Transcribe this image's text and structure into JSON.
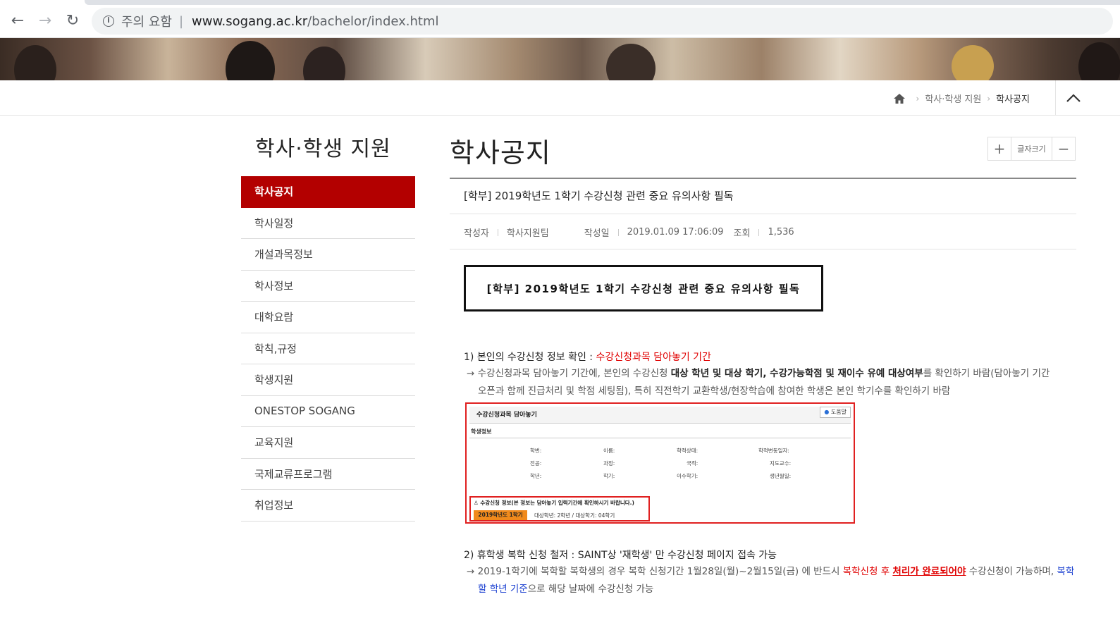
{
  "browser": {
    "security_warning": "주의 요함",
    "separator": "|",
    "url_host": "www.sogang.ac.kr",
    "url_path": "/bachelor/index.html",
    "back": "←",
    "forward": "→",
    "reload": "↻"
  },
  "breadcrumb": {
    "items": [
      "학사·학생 지원",
      "학사공지"
    ]
  },
  "lnb": {
    "title": "학사·학생 지원",
    "items": [
      {
        "label": "학사공지",
        "active": true
      },
      {
        "label": "학사일정"
      },
      {
        "label": "개설과목정보"
      },
      {
        "label": "학사정보"
      },
      {
        "label": "대학요람"
      },
      {
        "label": "학칙,규정"
      },
      {
        "label": "학생지원"
      },
      {
        "label": "ONESTOP SOGANG"
      },
      {
        "label": "교육지원"
      },
      {
        "label": "국제교류프로그램"
      },
      {
        "label": "취업정보"
      }
    ]
  },
  "content": {
    "page_title": "학사공지",
    "fontsize_label": "글자크기",
    "fontsize_plus": "+",
    "fontsize_minus": "−",
    "subject": "[학부] 2019학년도 1학기 수강신청 관련 중요 유의사항 필독",
    "meta": {
      "author_label": "작성자",
      "author": "학사지원팀",
      "date_label": "작성일",
      "date": "2019.01.09 17:06:09",
      "views_label": "조회",
      "views": "1,536"
    },
    "boxed_title": "[학부] 2019학년도 1학기 수강신청 관련 중요 유의사항 필독",
    "section1": {
      "head": "1) 본인의 수강신청 정보 확인 : ",
      "head_red": "수강신청과목 담아놓기 기간",
      "desc_a": "→ 수강신청과목 담아놓기 기간에, 본인의 수강신청 ",
      "desc_b": "대상 학년 및 대상 학기, 수강가능학점 및 재이수 유예 대상여부",
      "desc_c": "를 확인하기 바람(담아놓기 기간",
      "desc_line2": "오픈과 함께 진급처리 및 학점 세팅됨), 특히 직전학기 교환학생/현장학습에 참여한 학생은 본인 학기수를 확인하기 바람"
    },
    "screenshot": {
      "title": "수강신청과목 담아놓기",
      "help": "도움말",
      "sub": "학생정보",
      "fields": [
        "학번:",
        "이름:",
        "학적상태:",
        "학적변동일자:",
        "전공:",
        "과정:",
        "국적:",
        "지도교수:",
        "학년:",
        "학기:",
        "이수학기:",
        "생년월일:"
      ],
      "notice": "수강신청 정보(본 정보는 담아놓기 입력기간에 확인하시기 바랍니다.)",
      "semester": "2019학년도 1학기",
      "grade": "대상학년: 2학년    /    대상학기: 04학기"
    },
    "section2": {
      "head": "2) 휴학생 복학 신청 철저 : SAINT상 '재학생' 만 수강신청 페이지 접속 가능",
      "desc_a": "→ 2019-1학기에 복학할 복학생의 경우 복학 신청기간 1월28일(월)~2월15일(금) 에 반드시 ",
      "desc_red1": "복학신청 후 ",
      "desc_red2": "처리가 완료되어야",
      "desc_b": " 수강신청이 가능하며, ",
      "desc_blue1": "복학",
      "desc_blue2": "할 학년 기준",
      "desc_c": "으로 해당 날짜에 수강신청 가능"
    }
  },
  "colors": {
    "accent": "#b30000",
    "highlight_red": "#e00000",
    "highlight_blue": "#1a3fd0"
  }
}
